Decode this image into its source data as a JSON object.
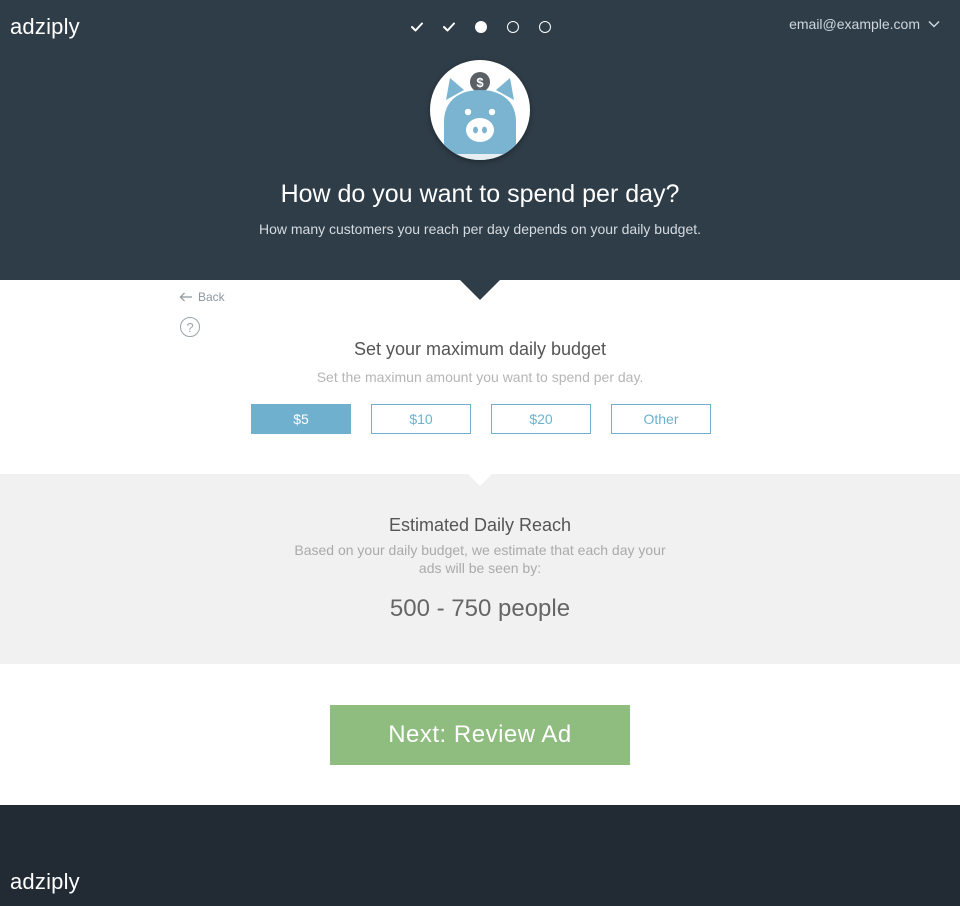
{
  "header": {
    "logo": "adziply",
    "account_email": "email@example.com",
    "steps": [
      "done",
      "done",
      "current",
      "todo",
      "todo"
    ],
    "title": "How do you want to spend per day?",
    "subtitle": "How many customers you reach per day depends on your daily budget."
  },
  "budget": {
    "back_label": "Back",
    "help_label": "?",
    "title": "Set your maximum daily budget",
    "subtitle": "Set the maximun amount you want to spend per day.",
    "options": [
      "$5",
      "$10",
      "$20",
      "Other"
    ],
    "selected_index": 0
  },
  "reach": {
    "title": "Estimated Daily Reach",
    "description": "Based on your daily budget, we estimate that each day your ads will be seen by:",
    "value": "500 - 750 people"
  },
  "next_button": {
    "label": "Next: Review Ad"
  },
  "footer": {
    "logo": "adziply"
  },
  "colors": {
    "header_bg": "#2f3d48",
    "accent_blue": "#6fb0cf",
    "next_green": "#8fbc7f",
    "reach_bg": "#f1f1f1",
    "footer_bg": "#222a33",
    "pig_blue": "#7ab4d0",
    "coin_gray": "#5a6166"
  },
  "icons": {
    "step_done": "check-icon",
    "step_current": "filled-circle-icon",
    "step_todo": "circle-outline-icon",
    "account_menu": "chevron-down-icon",
    "hero": "piggy-bank-icon",
    "back": "arrow-left-icon",
    "help": "question-circle-icon"
  }
}
